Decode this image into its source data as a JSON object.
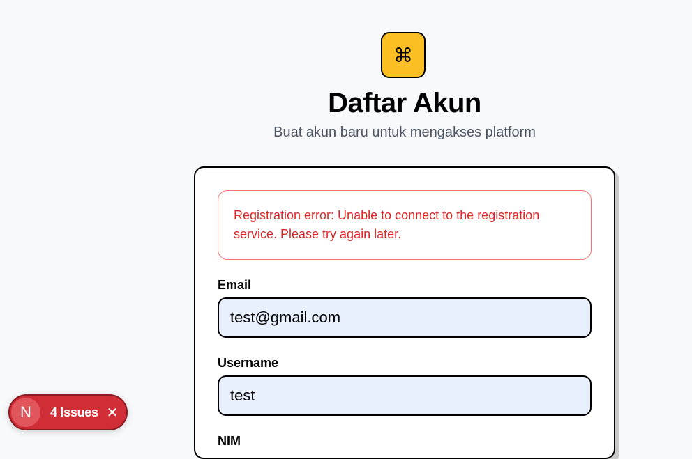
{
  "header": {
    "logo_icon": "command-icon",
    "logo_glyph": "⌘",
    "title": "Daftar Akun",
    "subtitle": "Buat akun baru untuk mengakses platform"
  },
  "form": {
    "error_message": "Registration error: Unable to connect to the registration service. Please try again later.",
    "fields": [
      {
        "label": "Email",
        "value": "test@gmail.com"
      },
      {
        "label": "Username",
        "value": "test"
      },
      {
        "label": "NIM",
        "value": ""
      }
    ]
  },
  "dev_overlay": {
    "badge_letter": "N",
    "issues_label": "4 Issues",
    "close_icon": "close-icon",
    "close_glyph": "✕"
  },
  "colors": {
    "background": "#f8f9fb",
    "logo_accent": "#fbbf24",
    "error_text": "#dc2626",
    "error_border": "#f87171",
    "input_fill": "#e8f0fe",
    "issues_pill": "#d12d36"
  }
}
